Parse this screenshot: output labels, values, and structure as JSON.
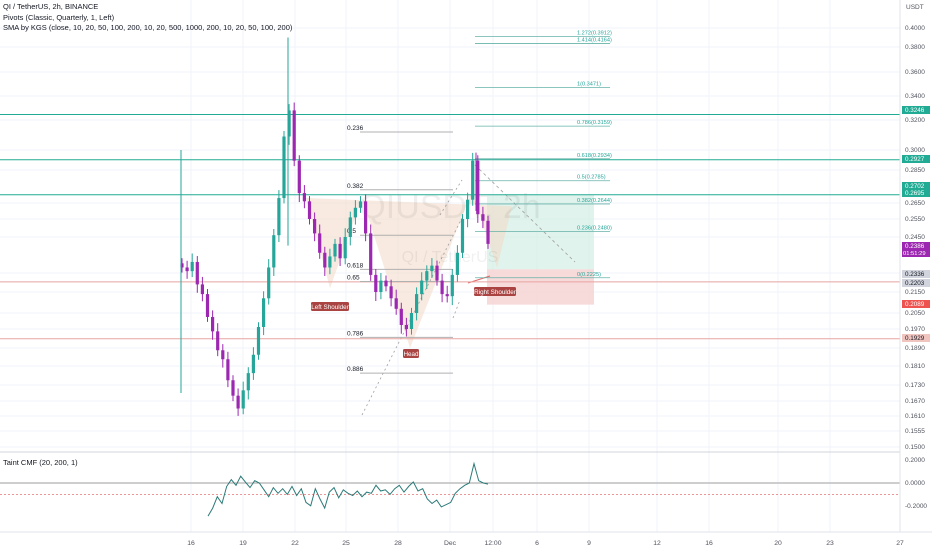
{
  "header": {
    "line1": "QI / TetherUS, 2h, BINANCE",
    "line2": "Pivots (Classic, Quarterly, 1, Left)",
    "line3": "SMA by KGS (close, 10, 20, 50, 100, 200, 10, 20, 500, 1000, 200, 10, 20, 50, 100, 200)"
  },
  "indicator": {
    "title": "Taint CMF (20, 200, 1)"
  },
  "watermark": {
    "symbol": "QIUSDT, 2h",
    "name": "QI / TetherUS"
  },
  "colors": {
    "background": "#ffffff",
    "grid": "#f0f3fa",
    "bull": "#26a69a",
    "bear": "#9c27b0",
    "teal_line": "#22ab94",
    "salmon_line": "#e8a5a0",
    "fib_line": "#b0b0b0",
    "pattern_fill": "#f3d9c6",
    "target_zone": "#d6efe6",
    "stop_zone": "#f6d4d4",
    "current_price": "#9c27b0",
    "cmf_line": "#2b7a78"
  },
  "chart_data": [
    {
      "type": "candlestick",
      "title": "QI / TetherUS, 2h, BINANCE",
      "y_axis_unit": "USDT",
      "y_ticks": [
        "0.4000",
        "0.3800",
        "0.3600",
        "0.3400",
        "0.3200",
        "0.3000",
        "0.2850",
        "0.2650",
        "0.2550",
        "0.2450",
        "0.2250",
        "0.2150",
        "0.2050",
        "0.1970",
        "0.1890",
        "0.1810",
        "0.1730",
        "0.1670",
        "0.1610",
        "0.1555",
        "0.1500"
      ],
      "x_ticks": [
        "16",
        "19",
        "22",
        "25",
        "28",
        "Dec",
        "12:00",
        "6",
        "9",
        "12",
        "16",
        "20",
        "23",
        "27"
      ],
      "ylim": [
        0.148,
        0.412
      ],
      "series": [
        {
          "name": "price",
          "x": "2h candles, 16 Nov – 1 Dec",
          "close": [
            0.228,
            0.226,
            0.231,
            0.219,
            0.214,
            0.203,
            0.196,
            0.188,
            0.184,
            0.175,
            0.169,
            0.164,
            0.171,
            0.178,
            0.186,
            0.198,
            0.212,
            0.228,
            0.246,
            0.268,
            0.309,
            0.328,
            0.292,
            0.271,
            0.266,
            0.255,
            0.247,
            0.236,
            0.228,
            0.234,
            0.241,
            0.233,
            0.245,
            0.256,
            0.262,
            0.266,
            0.247,
            0.224,
            0.215,
            0.221,
            0.218,
            0.212,
            0.207,
            0.199,
            0.197,
            0.205,
            0.214,
            0.221,
            0.226,
            0.229,
            0.221,
            0.214,
            0.213,
            0.224,
            0.236,
            0.255,
            0.267,
            0.292,
            0.258,
            0.254,
            0.241
          ]
        }
      ],
      "price_labels": [
        {
          "value": "0.3246",
          "kind": "teal"
        },
        {
          "value": "0.2927",
          "kind": "teal"
        },
        {
          "value": "0.2702",
          "kind": "teal"
        },
        {
          "value": "0.2695",
          "kind": "teal"
        },
        {
          "value": "0.2386",
          "kind": "current",
          "countdown": "01:51:29"
        },
        {
          "value": "0.2336",
          "kind": "light"
        },
        {
          "value": "0.2203",
          "kind": "light"
        },
        {
          "value": "0.2089",
          "kind": "red"
        },
        {
          "value": "0.1929",
          "kind": "salmon"
        }
      ],
      "horizontal_levels": [
        {
          "value": 0.3246,
          "kind": "teal"
        },
        {
          "value": 0.2927,
          "kind": "teal"
        },
        {
          "value": 0.27,
          "kind": "teal"
        },
        {
          "value": 0.2203,
          "kind": "salmon"
        },
        {
          "value": 0.1929,
          "kind": "salmon"
        }
      ],
      "fib_left": [
        {
          "label": "0.236",
          "value": 0.312
        },
        {
          "label": "0.382",
          "value": 0.273
        },
        {
          "label": "0.5",
          "value": 0.246
        },
        {
          "label": "0.618",
          "value": 0.227
        },
        {
          "label": "0.65",
          "value": 0.2205
        },
        {
          "label": "0.786",
          "value": 0.1935
        },
        {
          "label": "0.886",
          "value": 0.178
        }
      ],
      "fib_right": [
        {
          "label": "1.414(0.4164)",
          "value": 0.4164
        },
        {
          "label": "1.272(0.3912)",
          "value": 0.3912
        },
        {
          "label": "1(0.3471)",
          "value": 0.3471
        },
        {
          "label": "0.786(0.3159)",
          "value": 0.3159
        },
        {
          "label": "0.618(0.2934)",
          "value": 0.2934
        },
        {
          "label": "0.5(0.2785)",
          "value": 0.2785
        },
        {
          "label": "0.382(0.2644)",
          "value": 0.2644
        },
        {
          "label": "0.236(0.2480)",
          "value": 0.248
        },
        {
          "label": "0(0.2225)",
          "value": 0.2225
        }
      ],
      "pattern_labels": [
        {
          "text": "Left Shoulder"
        },
        {
          "text": "Head"
        },
        {
          "text": "Right Shoulder"
        }
      ]
    },
    {
      "type": "line",
      "title": "Taint CMF (20, 200, 1)",
      "y_ticks": [
        "0.2000",
        "0.0000",
        "-0.2000"
      ],
      "ylim": [
        -0.29,
        0.27
      ],
      "series": [
        {
          "name": "CMF",
          "values": [
            -0.29,
            -0.22,
            -0.12,
            -0.18,
            -0.03,
            0.03,
            -0.02,
            0.06,
            0.01,
            -0.04,
            0.02,
            0.0,
            -0.06,
            -0.12,
            -0.04,
            -0.09,
            -0.05,
            -0.1,
            -0.03,
            -0.11,
            -0.05,
            -0.17,
            -0.2,
            -0.05,
            -0.14,
            -0.22,
            -0.08,
            -0.04,
            -0.13,
            -0.06,
            -0.09,
            -0.11,
            -0.07,
            -0.12,
            -0.08,
            -0.09,
            -0.02,
            -0.07,
            -0.06,
            -0.1,
            -0.05,
            -0.02,
            -0.08,
            -0.03,
            0.01,
            -0.07,
            -0.05,
            -0.14,
            -0.18,
            -0.15,
            -0.21,
            -0.19,
            -0.17,
            -0.09,
            -0.05,
            -0.02,
            0.0,
            0.17,
            0.02,
            0.0,
            -0.01
          ]
        }
      ]
    }
  ]
}
